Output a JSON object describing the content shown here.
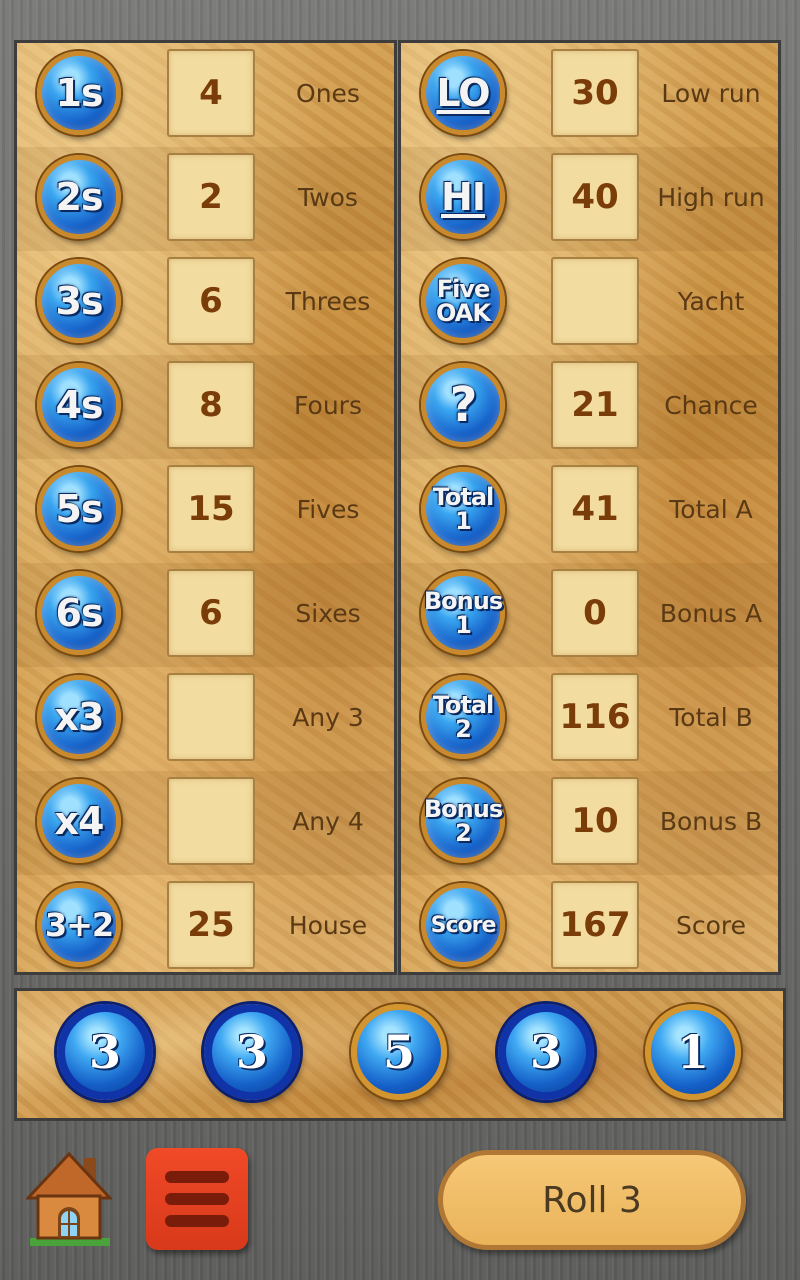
{
  "left_rows": [
    {
      "icon": "1s",
      "value": "4",
      "label": "Ones"
    },
    {
      "icon": "2s",
      "value": "2",
      "label": "Twos"
    },
    {
      "icon": "3s",
      "value": "6",
      "label": "Threes"
    },
    {
      "icon": "4s",
      "value": "8",
      "label": "Fours"
    },
    {
      "icon": "5s",
      "value": "15",
      "label": "Fives"
    },
    {
      "icon": "6s",
      "value": "6",
      "label": "Sixes"
    },
    {
      "icon": "x3",
      "value": "",
      "label": "Any 3"
    },
    {
      "icon": "x4",
      "value": "",
      "label": "Any 4"
    },
    {
      "icon": "3+2",
      "value": "25",
      "label": "House"
    }
  ],
  "right_rows": [
    {
      "icon": "LO",
      "value": "30",
      "label": "Low run"
    },
    {
      "icon": "HI",
      "value": "40",
      "label": "High run"
    },
    {
      "icon": "Five OAK",
      "value": "",
      "label": "Yacht"
    },
    {
      "icon": "?",
      "value": "21",
      "label": "Chance"
    },
    {
      "icon": "Total 1",
      "value": "41",
      "label": "Total A"
    },
    {
      "icon": "Bonus 1",
      "value": "0",
      "label": "Bonus A"
    },
    {
      "icon": "Total 2",
      "value": "116",
      "label": "Total B"
    },
    {
      "icon": "Bonus 2",
      "value": "10",
      "label": "Bonus B"
    },
    {
      "icon": "Score",
      "value": "167",
      "label": "Score"
    }
  ],
  "dice": [
    {
      "value": "3",
      "held": true
    },
    {
      "value": "3",
      "held": true
    },
    {
      "value": "5",
      "held": false
    },
    {
      "value": "3",
      "held": true
    },
    {
      "value": "1",
      "held": false
    }
  ],
  "controls": {
    "roll_label": "Roll 3",
    "home_icon": "house-icon",
    "menu_icon": "hamburger-menu-icon"
  },
  "colors": {
    "held_ring": "#1034a8",
    "free_ring": "#d2952f",
    "menu_button": "#e8441f",
    "roll_button": "#f0bd68"
  }
}
